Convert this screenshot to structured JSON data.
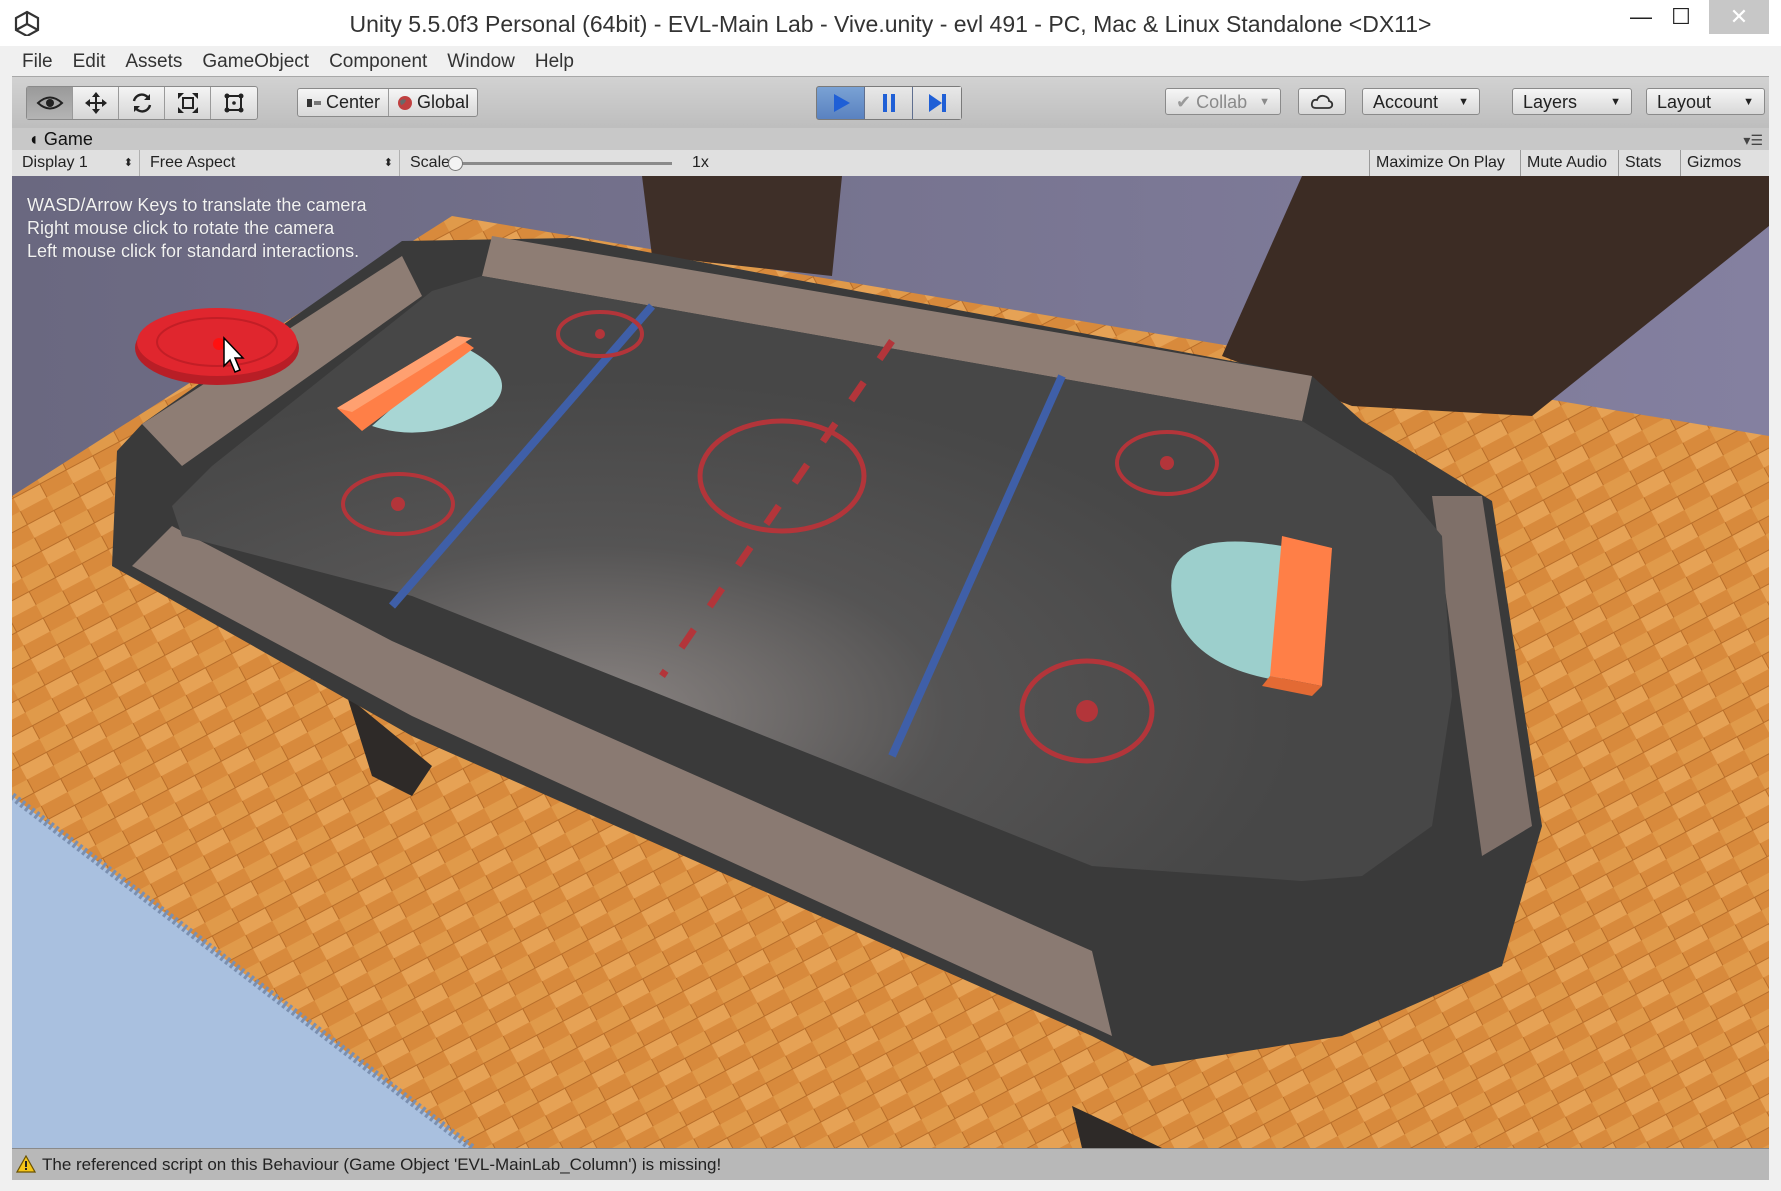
{
  "window": {
    "title": "Unity 5.5.0f3 Personal (64bit) - EVL-Main Lab - Vive.unity - evl 491 - PC, Mac & Linux Standalone <DX11>",
    "minimize": "—",
    "maximize": "☐",
    "close": "✕"
  },
  "menu": [
    "File",
    "Edit",
    "Assets",
    "GameObject",
    "Component",
    "Window",
    "Help"
  ],
  "toolbar": {
    "tools": [
      "view-tool",
      "move-tool",
      "rotate-tool",
      "scale-tool",
      "rect-tool"
    ],
    "pivot": "Center",
    "space": "Global",
    "collab": "Collab",
    "account": "Account",
    "layers": "Layers",
    "layout": "Layout",
    "play_state": "playing"
  },
  "game_view": {
    "tab": "Game",
    "display": "Display 1",
    "aspect": "Free Aspect",
    "scale_label": "Scale",
    "scale_value": "1x",
    "maximize_on_play": "Maximize On Play",
    "mute_audio": "Mute Audio",
    "stats": "Stats",
    "gizmos": "Gizmos",
    "hints": [
      "WASD/Arrow Keys to translate the camera",
      "Right mouse click to rotate the camera",
      "Left mouse click for standard interactions."
    ]
  },
  "status": {
    "message": "The referenced script on this Behaviour (Game Object 'EVL-MainLab_Column') is missing!"
  },
  "colors": {
    "play_accent": "#5a82c0",
    "table_surface": "#4a4a4a",
    "rail": "#8a7a72",
    "paddle": "#ff7f47",
    "goal": "#a8d6d4",
    "marking_red": "#b3353a",
    "marking_blue": "#3f5fa8",
    "puck": "#e0262e",
    "floor": "#d98a3a"
  }
}
